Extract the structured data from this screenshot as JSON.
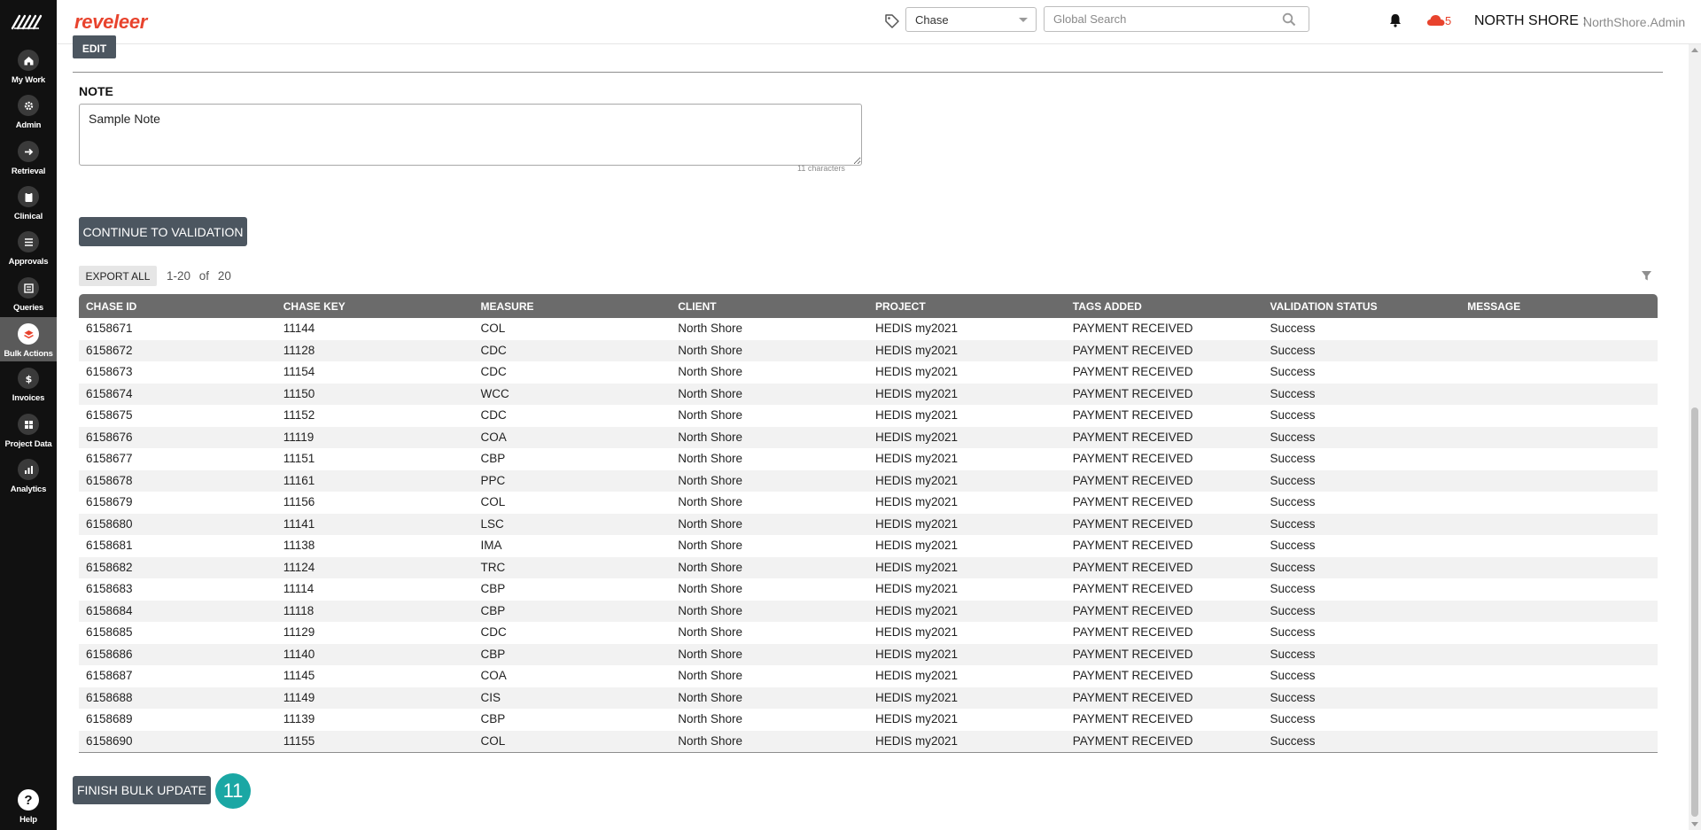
{
  "app": {
    "brand": "reveleer",
    "colors": {
      "brand": "#e8432d",
      "sidebar": "#111111",
      "button": "#4c5660",
      "table_header": "#6b6b6b",
      "badge": "#1aa7a4"
    }
  },
  "sidebar": {
    "logo_icon": "reveleer-logo-mark-icon",
    "items": [
      {
        "label": "My Work",
        "icon": "home-icon",
        "active": false
      },
      {
        "label": "Admin",
        "icon": "gear-icon",
        "active": false
      },
      {
        "label": "Retrieval",
        "icon": "arrow-right-icon",
        "active": false
      },
      {
        "label": "Clinical",
        "icon": "clipboard-icon",
        "active": false
      },
      {
        "label": "Approvals",
        "icon": "checklist-icon",
        "active": false
      },
      {
        "label": "Queries",
        "icon": "list-icon",
        "active": false
      },
      {
        "label": "Bulk Actions",
        "icon": "layers-icon",
        "active": true
      },
      {
        "label": "Invoices",
        "icon": "dollar-icon",
        "active": false
      },
      {
        "label": "Project Data",
        "icon": "grid-icon",
        "active": false
      },
      {
        "label": "Analytics",
        "icon": "bar-chart-icon",
        "active": false
      }
    ],
    "help": {
      "label": "Help",
      "icon": "question-icon",
      "glyph": "?"
    }
  },
  "header": {
    "search_type": "Chase",
    "search_placeholder": "Global Search",
    "cloud_count": "5",
    "org": "NORTH SHORE :",
    "user": "NorthShore.Admin"
  },
  "main": {
    "edit_label": "EDIT",
    "note_label": "NOTE",
    "note_value": "Sample Note",
    "char_count": "11 characters",
    "continue_label": "CONTINUE TO VALIDATION",
    "export_label": "EXPORT ALL",
    "pager": {
      "range": "1-20",
      "of": "of",
      "total": "20"
    },
    "finish_label": "FINISH BULK UPDATE",
    "step_badge": "11"
  },
  "table": {
    "columns": [
      "CHASE ID",
      "CHASE KEY",
      "MEASURE",
      "CLIENT",
      "PROJECT",
      "TAGS ADDED",
      "VALIDATION STATUS",
      "MESSAGE"
    ],
    "rows": [
      [
        "6158671",
        "11144",
        "COL",
        "North Shore",
        "HEDIS my2021",
        "PAYMENT RECEIVED",
        "Success",
        ""
      ],
      [
        "6158672",
        "11128",
        "CDC",
        "North Shore",
        "HEDIS my2021",
        "PAYMENT RECEIVED",
        "Success",
        ""
      ],
      [
        "6158673",
        "11154",
        "CDC",
        "North Shore",
        "HEDIS my2021",
        "PAYMENT RECEIVED",
        "Success",
        ""
      ],
      [
        "6158674",
        "11150",
        "WCC",
        "North Shore",
        "HEDIS my2021",
        "PAYMENT RECEIVED",
        "Success",
        ""
      ],
      [
        "6158675",
        "11152",
        "CDC",
        "North Shore",
        "HEDIS my2021",
        "PAYMENT RECEIVED",
        "Success",
        ""
      ],
      [
        "6158676",
        "11119",
        "COA",
        "North Shore",
        "HEDIS my2021",
        "PAYMENT RECEIVED",
        "Success",
        ""
      ],
      [
        "6158677",
        "11151",
        "CBP",
        "North Shore",
        "HEDIS my2021",
        "PAYMENT RECEIVED",
        "Success",
        ""
      ],
      [
        "6158678",
        "11161",
        "PPC",
        "North Shore",
        "HEDIS my2021",
        "PAYMENT RECEIVED",
        "Success",
        ""
      ],
      [
        "6158679",
        "11156",
        "COL",
        "North Shore",
        "HEDIS my2021",
        "PAYMENT RECEIVED",
        "Success",
        ""
      ],
      [
        "6158680",
        "11141",
        "LSC",
        "North Shore",
        "HEDIS my2021",
        "PAYMENT RECEIVED",
        "Success",
        ""
      ],
      [
        "6158681",
        "11138",
        "IMA",
        "North Shore",
        "HEDIS my2021",
        "PAYMENT RECEIVED",
        "Success",
        ""
      ],
      [
        "6158682",
        "11124",
        "TRC",
        "North Shore",
        "HEDIS my2021",
        "PAYMENT RECEIVED",
        "Success",
        ""
      ],
      [
        "6158683",
        "11114",
        "CBP",
        "North Shore",
        "HEDIS my2021",
        "PAYMENT RECEIVED",
        "Success",
        ""
      ],
      [
        "6158684",
        "11118",
        "CBP",
        "North Shore",
        "HEDIS my2021",
        "PAYMENT RECEIVED",
        "Success",
        ""
      ],
      [
        "6158685",
        "11129",
        "CDC",
        "North Shore",
        "HEDIS my2021",
        "PAYMENT RECEIVED",
        "Success",
        ""
      ],
      [
        "6158686",
        "11140",
        "CBP",
        "North Shore",
        "HEDIS my2021",
        "PAYMENT RECEIVED",
        "Success",
        ""
      ],
      [
        "6158687",
        "11145",
        "COA",
        "North Shore",
        "HEDIS my2021",
        "PAYMENT RECEIVED",
        "Success",
        ""
      ],
      [
        "6158688",
        "11149",
        "CIS",
        "North Shore",
        "HEDIS my2021",
        "PAYMENT RECEIVED",
        "Success",
        ""
      ],
      [
        "6158689",
        "11139",
        "CBP",
        "North Shore",
        "HEDIS my2021",
        "PAYMENT RECEIVED",
        "Success",
        ""
      ],
      [
        "6158690",
        "11155",
        "COL",
        "North Shore",
        "HEDIS my2021",
        "PAYMENT RECEIVED",
        "Success",
        ""
      ]
    ]
  }
}
